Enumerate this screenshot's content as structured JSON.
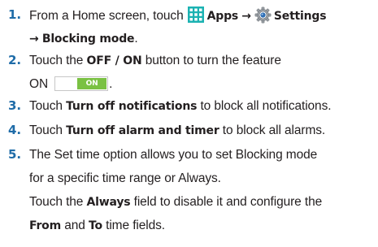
{
  "steps": [
    {
      "number": "1.",
      "line1_prefix": "From a Home screen, touch",
      "apps_icon": "apps-grid-icon",
      "apps_label": "Apps",
      "arrow1": "→",
      "settings_icon": "settings-gear-icon",
      "settings_label": "Settings",
      "arrow2": "→",
      "blocking_mode_label": "Blocking mode",
      "line2_suffix": "."
    },
    {
      "number": "2.",
      "line1_prefix": "Touch the",
      "offon_label": "OFF / ON",
      "line1_suffix": "button to turn the feature",
      "line2_prefix": "ON",
      "toggle_label": "ON",
      "line2_suffix": "."
    },
    {
      "number": "3.",
      "prefix": "Touch",
      "bold": "Turn off notifications",
      "suffix": "to block all notifications."
    },
    {
      "number": "4.",
      "prefix": "Touch",
      "bold": "Turn off alarm and timer",
      "suffix": "to block all alarms."
    },
    {
      "number": "5.",
      "line1": "The Set time option allows you to set Blocking mode",
      "line2": "for a specific time range or Always.",
      "line3_prefix": "Touch the",
      "line3_bold": "Always",
      "line3_suffix": "field to disable it and configure the",
      "line4_bold1": "From",
      "line4_mid": "and",
      "line4_bold2": "To",
      "line4_suffix": "time fields."
    }
  ],
  "colors": {
    "step_number": "#1f6ca8",
    "body_text": "#231f20",
    "apps_icon": "#1bb2b2",
    "toggle_on": "#7ac143"
  }
}
